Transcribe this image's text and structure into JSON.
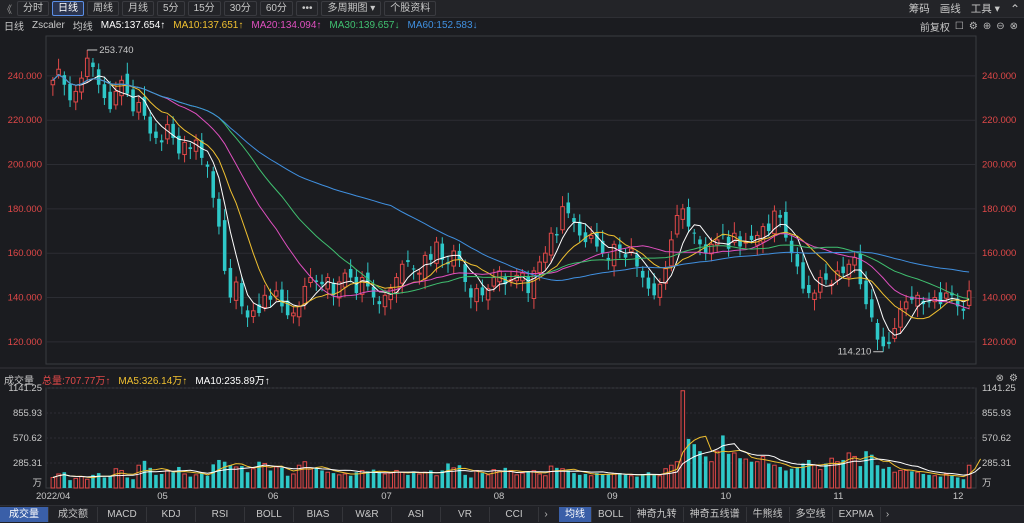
{
  "toolbar": {
    "back_label": "《",
    "periods": [
      "分时",
      "日线",
      "周线",
      "月线",
      "5分",
      "15分",
      "30分",
      "60分",
      "•••",
      "多周期图 ▾",
      "个股资料"
    ],
    "active_period": 1,
    "right_items": [
      "筹码",
      "画线",
      "工具 ▾"
    ]
  },
  "legend": {
    "period": "日线",
    "symbol": "Zscaler",
    "ma_label": "均线",
    "ma5": "MA5:137.654↑",
    "ma10": "MA10:137.651↑",
    "ma20": "MA20:134.094↑",
    "ma30": "MA30:139.657↓",
    "ma60": "MA60:152.583↓",
    "adjust": "前复权"
  },
  "colors": {
    "up": "#e04848",
    "down": "#2ec8c8",
    "ma5": "#ffffff",
    "ma10": "#f0c030",
    "ma20": "#e050c0",
    "ma30": "#40c070",
    "ma60": "#4090e0",
    "price_axis": "#e04848",
    "grid": "#2c2d33"
  },
  "price_axis": {
    "labels": [
      "240.000",
      "220.000",
      "200.000",
      "180.000",
      "160.000",
      "140.000",
      "120.000"
    ],
    "values": [
      240,
      220,
      200,
      180,
      160,
      140,
      120
    ]
  },
  "annotations": {
    "high": "253.740",
    "low": "114.210"
  },
  "volume_legend": {
    "title": "成交量",
    "total": "总量:707.77万↑",
    "ma5": "MA5:326.14万↑",
    "ma10": "MA10:235.89万↑"
  },
  "volume_axis": {
    "labels": [
      "1141.25",
      "855.93",
      "570.62",
      "285.31",
      "万"
    ],
    "values": [
      1141.25,
      855.93,
      570.62,
      285.31
    ]
  },
  "time_axis": [
    "2022/04",
    "05",
    "06",
    "07",
    "08",
    "09",
    "10",
    "11",
    "12"
  ],
  "bottom_tabs": [
    "成交量",
    "成交额",
    "MACD",
    "KDJ",
    "RSI",
    "BOLL",
    "BIAS",
    "W&R",
    "ASI",
    "VR",
    "CCI"
  ],
  "bottom_tabs_active": 0,
  "bottom_tabs_right": [
    "均线",
    "BOLL",
    "神奇九转",
    "神奇五线谱",
    "牛熊线",
    "多空线",
    "EXPMA"
  ],
  "bottom_tabs_right_active": 0,
  "chart_data": {
    "type": "candlestick",
    "ylim": [
      110,
      258
    ],
    "volume_ylim": [
      0,
      1141.25
    ],
    "closes": [
      238,
      243,
      236,
      229,
      233,
      239,
      248,
      244,
      236,
      230,
      225,
      233,
      238,
      232,
      224,
      228,
      222,
      214,
      212,
      210,
      218,
      212,
      205,
      210,
      207,
      211,
      203,
      199,
      185,
      172,
      152,
      140,
      147,
      136,
      131,
      134,
      133,
      141,
      139,
      143,
      136,
      132,
      133,
      136,
      145,
      149,
      147,
      146,
      149,
      141,
      147,
      151,
      149,
      142,
      149,
      145,
      140,
      137,
      141,
      144,
      149,
      155,
      156,
      153,
      151,
      159,
      157,
      165,
      157,
      155,
      161,
      157,
      147,
      140,
      144,
      141,
      144,
      149,
      152,
      146,
      148,
      150,
      151,
      142,
      152,
      156,
      160,
      169,
      168,
      181,
      178,
      174,
      168,
      165,
      168,
      163,
      160,
      157,
      164,
      161,
      158,
      162,
      154,
      149,
      144,
      141,
      146,
      153,
      166,
      177,
      180,
      172,
      169,
      164,
      160,
      164,
      166,
      168,
      162,
      169,
      163,
      165,
      166,
      168,
      172,
      170,
      179,
      176,
      167,
      160,
      154,
      144,
      142,
      142,
      149,
      148,
      146,
      152,
      151,
      155,
      158,
      146,
      137,
      131,
      121,
      118,
      119,
      126,
      135,
      138,
      139,
      141,
      137,
      138,
      140,
      137,
      142,
      141,
      136,
      134,
      143
    ],
    "volumes": [
      120,
      160,
      180,
      90,
      110,
      130,
      100,
      150,
      170,
      120,
      140,
      220,
      200,
      120,
      100,
      260,
      310,
      230,
      150,
      160,
      200,
      180,
      240,
      160,
      130,
      150,
      170,
      140,
      270,
      320,
      300,
      260,
      240,
      250,
      180,
      220,
      300,
      280,
      200,
      240,
      230,
      140,
      160,
      260,
      300,
      220,
      230,
      200,
      180,
      170,
      150,
      160,
      140,
      180,
      200,
      190,
      210,
      180,
      160,
      170,
      200,
      180,
      150,
      190,
      160,
      180,
      200,
      140,
      200,
      280,
      230,
      260,
      150,
      120,
      200,
      170,
      150,
      210,
      190,
      230,
      200,
      150,
      170,
      190,
      200,
      160,
      140,
      250,
      230,
      220,
      200,
      170,
      150,
      160,
      140,
      170,
      150,
      160,
      160,
      170,
      150,
      140,
      130,
      160,
      180,
      150,
      140,
      220,
      260,
      300,
      1110,
      560,
      500,
      420,
      360,
      300,
      420,
      600,
      390,
      400,
      340,
      330,
      300,
      300,
      360,
      280,
      260,
      240,
      200,
      220,
      240,
      280,
      320,
      260,
      210,
      280,
      340,
      300,
      320,
      400,
      360,
      250,
      420,
      380,
      260,
      220,
      240,
      180,
      200,
      200,
      190,
      180,
      160,
      150,
      140,
      130,
      160,
      140,
      120,
      100,
      260,
      470,
      710
    ]
  }
}
